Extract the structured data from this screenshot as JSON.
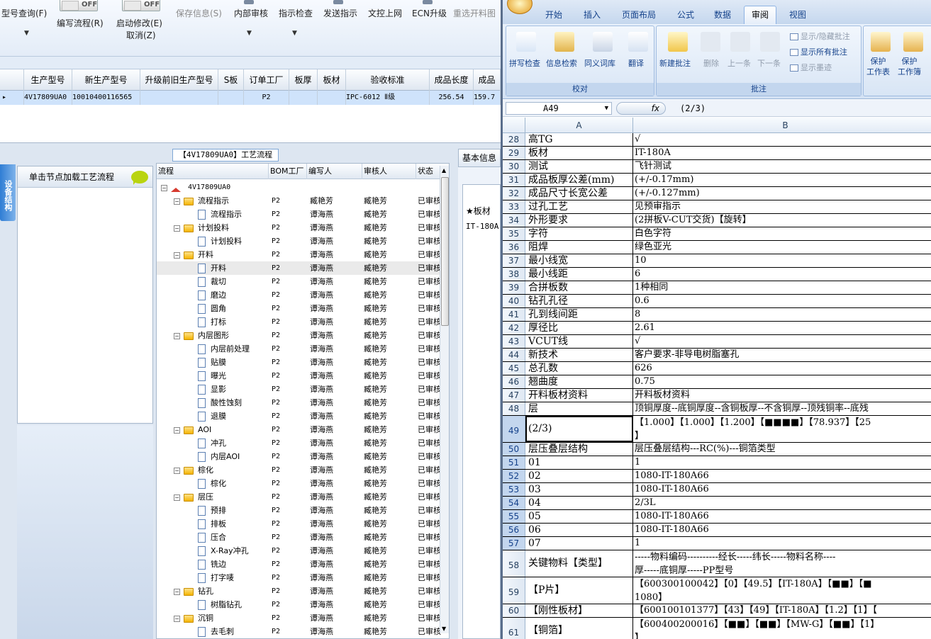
{
  "left_app": {
    "toolbar": {
      "query_label": "型号查询(F)",
      "edit_flow_label": "编写流程(R)",
      "enable_modify_label": "启动修改(E)",
      "cancel_label": "取消(Z)",
      "save_info_label": "保存信息(S)",
      "internal_review_label": "内部审核",
      "instruction_check_label": "指示检查",
      "send_instruction_label": "发送指示",
      "upload_label": "文控上网",
      "ecn_upgrade_label": "ECN升级",
      "reselect_label": "重选开料图",
      "toggle_off_label": "OFF"
    },
    "grid": {
      "headers": [
        "生产型号",
        "新生产型号",
        "升级前旧生产型号",
        "S板",
        "订单工厂",
        "板厚",
        "板材",
        "验收标准",
        "成品长度",
        "成品"
      ],
      "row": [
        "4V17809UA0",
        "10010400116565",
        "",
        "",
        "P2",
        "",
        "",
        "IPC-6012 Ⅱ级",
        "256.54",
        "159.7"
      ]
    },
    "side_tab_label": "设备结构",
    "side_panel_title": "单击节点加载工艺流程",
    "process_title": "【4V17809UA0】工艺流程",
    "tree": {
      "headers": [
        "流程",
        "BOM工厂",
        "编写人",
        "审核人",
        "状态"
      ],
      "root": "4V17809UA0",
      "rows": [
        {
          "level": 1,
          "type": "folder",
          "name": "流程指示",
          "bom": "P2",
          "writer": "臧艳芳",
          "reviewer": "臧艳芳",
          "status": "已审核"
        },
        {
          "level": 2,
          "type": "doc",
          "name": "流程指示",
          "bom": "P2",
          "writer": "谭海燕",
          "reviewer": "臧艳芳",
          "status": "已审核"
        },
        {
          "level": 1,
          "type": "folder",
          "name": "计划投料",
          "bom": "P2",
          "writer": "谭海燕",
          "reviewer": "臧艳芳",
          "status": "已审核"
        },
        {
          "level": 2,
          "type": "doc",
          "name": "计划投料",
          "bom": "P2",
          "writer": "谭海燕",
          "reviewer": "臧艳芳",
          "status": "已审核"
        },
        {
          "level": 1,
          "type": "folder",
          "name": "开料",
          "bom": "P2",
          "writer": "谭海燕",
          "reviewer": "臧艳芳",
          "status": "已审核"
        },
        {
          "level": 2,
          "type": "doc",
          "name": "开料",
          "bom": "P2",
          "writer": "谭海燕",
          "reviewer": "臧艳芳",
          "status": "已审核"
        },
        {
          "level": 2,
          "type": "doc",
          "name": "裁切",
          "bom": "P2",
          "writer": "谭海燕",
          "reviewer": "臧艳芳",
          "status": "已审核"
        },
        {
          "level": 2,
          "type": "doc",
          "name": "磨边",
          "bom": "P2",
          "writer": "谭海燕",
          "reviewer": "臧艳芳",
          "status": "已审核"
        },
        {
          "level": 2,
          "type": "doc",
          "name": "圆角",
          "bom": "P2",
          "writer": "谭海燕",
          "reviewer": "臧艳芳",
          "status": "已审核"
        },
        {
          "level": 2,
          "type": "doc",
          "name": "打标",
          "bom": "P2",
          "writer": "谭海燕",
          "reviewer": "臧艳芳",
          "status": "已审核"
        },
        {
          "level": 1,
          "type": "folder",
          "name": "内层图形",
          "bom": "P2",
          "writer": "谭海燕",
          "reviewer": "臧艳芳",
          "status": "已审核"
        },
        {
          "level": 2,
          "type": "doc",
          "name": "内层前处理",
          "bom": "P2",
          "writer": "谭海燕",
          "reviewer": "臧艳芳",
          "status": "已审核"
        },
        {
          "level": 2,
          "type": "doc",
          "name": "贴膜",
          "bom": "P2",
          "writer": "谭海燕",
          "reviewer": "臧艳芳",
          "status": "已审核"
        },
        {
          "level": 2,
          "type": "doc",
          "name": "曝光",
          "bom": "P2",
          "writer": "谭海燕",
          "reviewer": "臧艳芳",
          "status": "已审核"
        },
        {
          "level": 2,
          "type": "doc",
          "name": "显影",
          "bom": "P2",
          "writer": "谭海燕",
          "reviewer": "臧艳芳",
          "status": "已审核"
        },
        {
          "level": 2,
          "type": "doc",
          "name": "酸性蚀刻",
          "bom": "P2",
          "writer": "谭海燕",
          "reviewer": "臧艳芳",
          "status": "已审核"
        },
        {
          "level": 2,
          "type": "doc",
          "name": "退膜",
          "bom": "P2",
          "writer": "谭海燕",
          "reviewer": "臧艳芳",
          "status": "已审核"
        },
        {
          "level": 1,
          "type": "folder",
          "name": "AOI",
          "bom": "P2",
          "writer": "谭海燕",
          "reviewer": "臧艳芳",
          "status": "已审核"
        },
        {
          "level": 2,
          "type": "doc",
          "name": "冲孔",
          "bom": "P2",
          "writer": "谭海燕",
          "reviewer": "臧艳芳",
          "status": "已审核"
        },
        {
          "level": 2,
          "type": "doc",
          "name": "内层AOI",
          "bom": "P2",
          "writer": "谭海燕",
          "reviewer": "臧艳芳",
          "status": "已审核"
        },
        {
          "level": 1,
          "type": "folder",
          "name": "棕化",
          "bom": "P2",
          "writer": "谭海燕",
          "reviewer": "臧艳芳",
          "status": "已审核"
        },
        {
          "level": 2,
          "type": "doc",
          "name": "棕化",
          "bom": "P2",
          "writer": "谭海燕",
          "reviewer": "臧艳芳",
          "status": "已审核"
        },
        {
          "level": 1,
          "type": "folder",
          "name": "层压",
          "bom": "P2",
          "writer": "谭海燕",
          "reviewer": "臧艳芳",
          "status": "已审核"
        },
        {
          "level": 2,
          "type": "doc",
          "name": "预排",
          "bom": "P2",
          "writer": "谭海燕",
          "reviewer": "臧艳芳",
          "status": "已审核"
        },
        {
          "level": 2,
          "type": "doc",
          "name": "排板",
          "bom": "P2",
          "writer": "谭海燕",
          "reviewer": "臧艳芳",
          "status": "已审核"
        },
        {
          "level": 2,
          "type": "doc",
          "name": "压合",
          "bom": "P2",
          "writer": "谭海燕",
          "reviewer": "臧艳芳",
          "status": "已审核"
        },
        {
          "level": 2,
          "type": "doc",
          "name": "X-Ray冲孔",
          "bom": "P2",
          "writer": "谭海燕",
          "reviewer": "臧艳芳",
          "status": "已审核"
        },
        {
          "level": 2,
          "type": "doc",
          "name": "铣边",
          "bom": "P2",
          "writer": "谭海燕",
          "reviewer": "臧艳芳",
          "status": "已审核"
        },
        {
          "level": 2,
          "type": "doc",
          "name": "打字唛",
          "bom": "P2",
          "writer": "谭海燕",
          "reviewer": "臧艳芳",
          "status": "已审核"
        },
        {
          "level": 1,
          "type": "folder",
          "name": "钻孔",
          "bom": "P2",
          "writer": "谭海燕",
          "reviewer": "臧艳芳",
          "status": "已审核"
        },
        {
          "level": 2,
          "type": "doc",
          "name": "树脂钻孔",
          "bom": "P2",
          "writer": "谭海燕",
          "reviewer": "臧艳芳",
          "status": "已审核"
        },
        {
          "level": 1,
          "type": "folder",
          "name": "沉铜",
          "bom": "P2",
          "writer": "谭海燕",
          "reviewer": "臧艳芳",
          "status": "已审核"
        },
        {
          "level": 2,
          "type": "doc",
          "name": "去毛刺",
          "bom": "P2",
          "writer": "谭海燕",
          "reviewer": "臧艳芳",
          "status": "已审核"
        }
      ]
    },
    "basic_info": {
      "tab_label": "基本信息",
      "col_header": "★板材",
      "value": "IT-180A"
    }
  },
  "excel": {
    "tabs": [
      "开始",
      "插入",
      "页面布局",
      "公式",
      "数据",
      "审阅",
      "视图"
    ],
    "active_tab": "审阅",
    "groups": {
      "proof": {
        "label": "校对",
        "buttons": [
          "拼写检查",
          "信息检索",
          "同义词库",
          "翻译"
        ]
      },
      "comments": {
        "label": "批注",
        "buttons": [
          "新建批注",
          "删除",
          "上一条",
          "下一条"
        ],
        "small": [
          "显示/隐藏批注",
          "显示所有批注",
          "显示墨迹"
        ]
      },
      "protect": {
        "buttons": [
          "保护\n工作表",
          "保护\n工作簿"
        ]
      }
    },
    "name_box": "A49",
    "fx_label": "fx",
    "formula": "(2/3)",
    "columns": [
      "A",
      "B"
    ],
    "rows": [
      {
        "n": "28",
        "a": "高TG",
        "b": "√"
      },
      {
        "n": "29",
        "a": "板材",
        "b": "IT-180A"
      },
      {
        "n": "30",
        "a": "测试",
        "b": "飞针测试"
      },
      {
        "n": "31",
        "a": "成品板厚公差(mm)",
        "b": "(+/-0.17mm)"
      },
      {
        "n": "32",
        "a": "成品尺寸长宽公差",
        "b": "(+/-0.127mm)"
      },
      {
        "n": "33",
        "a": "过孔工艺",
        "b": "见预审指示"
      },
      {
        "n": "34",
        "a": "外形要求",
        "b": "(2拼板V-CUT交货)【旋转】"
      },
      {
        "n": "35",
        "a": "字符",
        "b": "白色字符"
      },
      {
        "n": "36",
        "a": "阻焊",
        "b": "绿色亚光"
      },
      {
        "n": "37",
        "a": "最小线宽",
        "b": "10"
      },
      {
        "n": "38",
        "a": "最小线距",
        "b": "6"
      },
      {
        "n": "39",
        "a": "合拼板数",
        "b": "1种相同"
      },
      {
        "n": "40",
        "a": "钻孔孔径",
        "b": "0.6"
      },
      {
        "n": "41",
        "a": "孔到线间距",
        "b": "8"
      },
      {
        "n": "42",
        "a": "厚径比",
        "b": "2.61"
      },
      {
        "n": "43",
        "a": "VCUT线",
        "b": "√"
      },
      {
        "n": "44",
        "a": "新技术",
        "b": "客户要求-非导电树脂塞孔"
      },
      {
        "n": "45",
        "a": "总孔数",
        "b": "626"
      },
      {
        "n": "46",
        "a": "翘曲度",
        "b": "0.75"
      },
      {
        "n": "47",
        "a": "开料板材资料",
        "b": "开料板材资料"
      },
      {
        "n": "48",
        "a": "层",
        "b": "顶铜厚度--底铜厚度--含铜板厚--不含铜厚--顶残铜率--底残"
      },
      {
        "n": "49",
        "a": "(2/3)",
        "b": "【1.000】【1.000】【1.200】【■■■■】【78.937】【25",
        "b2": "】"
      },
      {
        "n": "50",
        "a": "层压叠层结构",
        "b": "层压叠层结构---RC(%)---铜箔类型"
      },
      {
        "n": "51",
        "a": "01",
        "b": "1"
      },
      {
        "n": "52",
        "a": "02",
        "b": "1080-IT-180A66"
      },
      {
        "n": "53",
        "a": "03",
        "b": "1080-IT-180A66"
      },
      {
        "n": "54",
        "a": "04",
        "b": "2/3L"
      },
      {
        "n": "55",
        "a": "05",
        "b": "1080-IT-180A66"
      },
      {
        "n": "56",
        "a": "06",
        "b": "1080-IT-180A66"
      },
      {
        "n": "57",
        "a": "07",
        "b": "1"
      },
      {
        "n": "58",
        "a": "关键物料【类型】",
        "b": "-----物料编码----------经长-----纬长-----物料名称----",
        "b2": "厚-----底铜厚-----PP型号"
      },
      {
        "n": "59",
        "a": "【P片】",
        "b": "【600300100042】【0】【49.5】【IT-180A】【■■】【■",
        "b2": "1080】"
      },
      {
        "n": "60",
        "a": "【刚性板材】",
        "b": "【600100101377】【43】【49】【IT-180A】【1.2】【1】【"
      },
      {
        "n": "61",
        "a": "【铜箔】",
        "b": "【600400200016】【■■】【■■】【MW-G】【■■】【1】",
        "b2": "】"
      }
    ]
  }
}
